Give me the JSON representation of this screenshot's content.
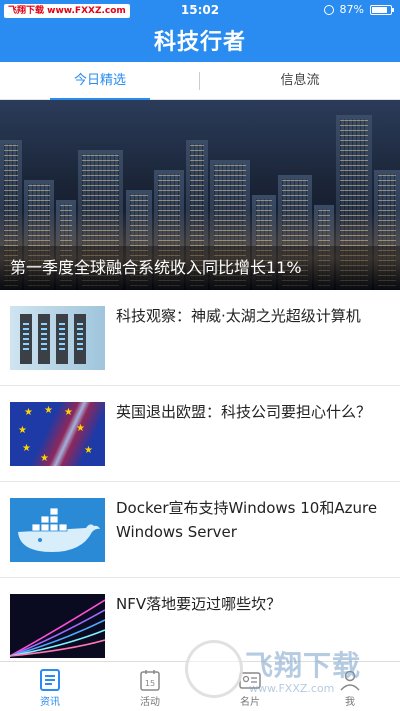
{
  "status_bar": {
    "watermark": "飞翔下载 www.FXXZ.com",
    "time": "15:02",
    "battery": "87%"
  },
  "header": {
    "title": "科技行者"
  },
  "tabs": [
    {
      "label": "今日精选",
      "active": true
    },
    {
      "label": "信息流",
      "active": false
    }
  ],
  "hero": {
    "caption": "第一季度全球融合系统收入同比增长11%"
  },
  "articles": [
    {
      "title": "科技观察：神威·太湖之光超级计算机"
    },
    {
      "title": "英国退出欧盟：科技公司要担心什么？"
    },
    {
      "title": "Docker宣布支持Windows 10和Azure Windows Server"
    },
    {
      "title": "NFV落地要迈过哪些坎？"
    }
  ],
  "bottom_nav": [
    {
      "label": "资讯",
      "icon": "news-icon",
      "active": true
    },
    {
      "label": "活动",
      "icon": "calendar-icon",
      "active": false,
      "badge": "15"
    },
    {
      "label": "名片",
      "icon": "card-icon",
      "active": false
    },
    {
      "label": "我",
      "icon": "user-icon",
      "active": false
    }
  ],
  "watermark": {
    "text": "飞翔下载",
    "url": "www.FXXZ.com"
  },
  "colors": {
    "accent": "#2a8cf0",
    "header_bg": "#2a8cf0"
  }
}
